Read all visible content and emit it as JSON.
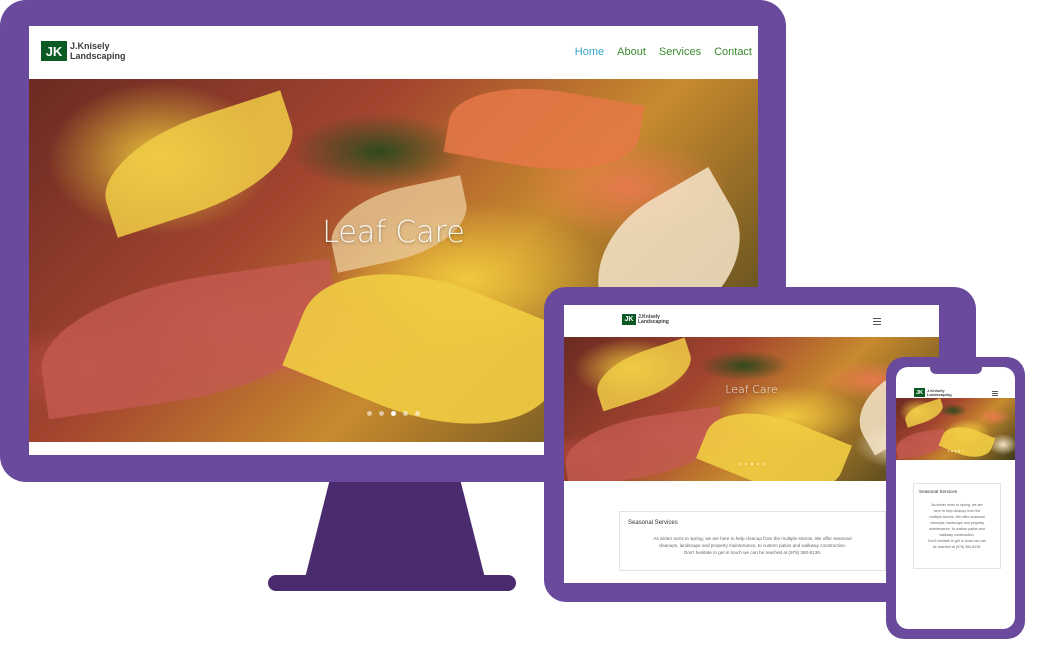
{
  "brand": {
    "logo_mark": "JK",
    "logo_line1": "J.Knisely",
    "logo_line2": "Landscaping",
    "device_color": "#6a4a9c",
    "stand_color": "#4a2c6e",
    "accent_green": "#3a8a2c",
    "accent_blue": "#35a4c9"
  },
  "nav": [
    {
      "label": "Home",
      "active": true
    },
    {
      "label": "About",
      "active": false
    },
    {
      "label": "Services",
      "active": false
    },
    {
      "label": "Contact",
      "active": false
    }
  ],
  "hero": {
    "title": "Leaf Care",
    "slides": 5,
    "active_slide": 3
  },
  "menu_icon": "hamburger-icon",
  "section": {
    "title": "Seasonal Services",
    "body_tablet_lines": [
      "As winter turns to spring, we are here to help cleanup from the multiple storms. We offer seasonal",
      "cleanups, landscape and property maintenance, to custom patios and walkway construction.",
      "Don't hesitate to get in touch we can be reached at (978) 360-8139."
    ],
    "body_phone_lines": [
      "As winter turns to spring, we are",
      "here to help cleanup from the",
      "multiple storms. We offer seasonal",
      "cleanups, landscape and property",
      "maintenance, to custom patios and",
      "walkway construction.",
      "Don't hesitate to get in touch we can",
      "be reached at (978) 360-8139."
    ]
  }
}
